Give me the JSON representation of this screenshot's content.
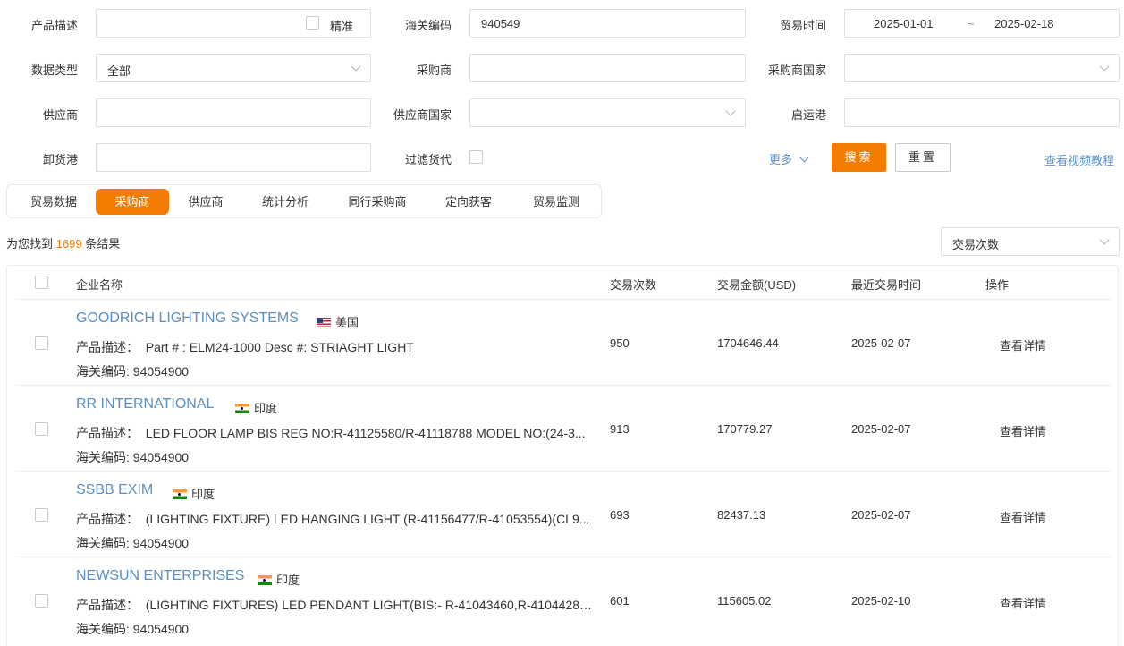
{
  "filters": {
    "product_desc_label": "产品描述",
    "exact_label": "精准",
    "hs_code_label": "海关编码",
    "hs_code_value": "940549",
    "trade_time_label": "贸易时间",
    "date_from": "2025-01-01",
    "date_sep": "~",
    "date_to": "2025-02-18",
    "data_type_label": "数据类型",
    "data_type_value": "全部",
    "buyer_label": "采购商",
    "buyer_country_label": "采购商国家",
    "supplier_label": "供应商",
    "supplier_country_label": "供应商国家",
    "origin_port_label": "启运港",
    "dest_port_label": "卸货港",
    "filter_forwarder_label": "过滤货代",
    "more_label": "更多",
    "search_label": "搜索",
    "reset_label": "重置",
    "tutorial_label": "查看视频教程"
  },
  "tabs": [
    "贸易数据",
    "采购商",
    "供应商",
    "统计分析",
    "同行采购商",
    "定向获客",
    "贸易监测"
  ],
  "active_tab": "采购商",
  "results": {
    "prefix": "为您找到",
    "count": "1699",
    "suffix": "条结果",
    "sort_value": "交易次数"
  },
  "table": {
    "headers": {
      "company": "企业名称",
      "trades": "交易次数",
      "amount": "交易金额(USD)",
      "last_trade": "最近交易时间",
      "action": "操作"
    },
    "desc_prefix": "产品描述：",
    "hs_prefix": "海关编码:",
    "rows": [
      {
        "company": "GOODRICH LIGHTING SYSTEMS",
        "country": "美国",
        "flag": "us-flag-icon",
        "desc": "Part # : ELM24-1000 Desc #: STRIAGHT LIGHT",
        "hs": "94054900",
        "trades": "950",
        "amount": "1704646.44",
        "last_trade": "2025-02-07",
        "action": "查看详情"
      },
      {
        "company": "RR INTERNATIONAL",
        "country": "印度",
        "flag": "india-flag-icon",
        "desc": "LED FLOOR LAMP BIS REG NO:R-41125580/R-41118788 MODEL NO:(24-3...",
        "hs": "94054900",
        "trades": "913",
        "amount": "170779.27",
        "last_trade": "2025-02-07",
        "action": "查看详情"
      },
      {
        "company": "SSBB EXIM",
        "country": "印度",
        "flag": "india-flag-icon",
        "desc": "(LIGHTING FIXTURE) LED HANGING LIGHT (R-41156477/R-41053554)(CL9...",
        "hs": "94054900",
        "trades": "693",
        "amount": "82437.13",
        "last_trade": "2025-02-07",
        "action": "查看详情"
      },
      {
        "company": "NEWSUN ENTERPRISES",
        "country": "印度",
        "flag": "india-flag-icon",
        "desc": "(LIGHTING FIXTURES) LED PENDANT LIGHT(BIS:- R-41043460,R-41044288...",
        "hs": "94054900",
        "trades": "601",
        "amount": "115605.02",
        "last_trade": "2025-02-10",
        "action": "查看详情"
      }
    ]
  },
  "colors": {
    "accent": "#f57c00",
    "link": "#5b8fc3"
  }
}
